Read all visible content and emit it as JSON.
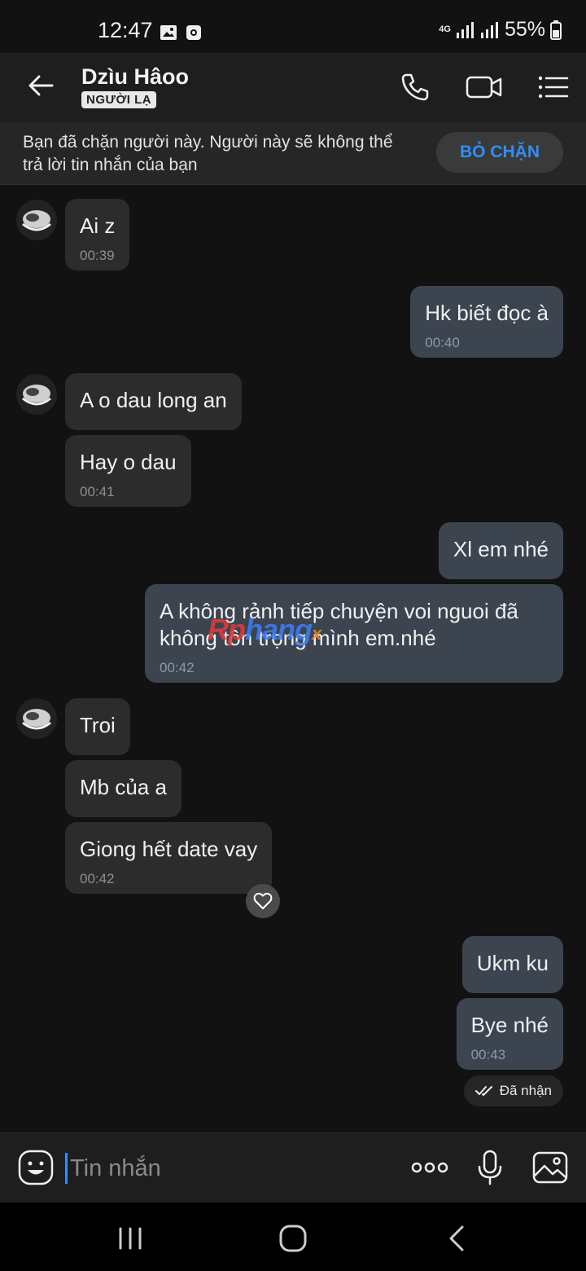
{
  "status_bar": {
    "time": "12:47",
    "network": "4G",
    "battery": "55%"
  },
  "header": {
    "contact_name": "Dzìu Hâoo",
    "badge": "NGƯỜI LẠ"
  },
  "banner": {
    "text": "Bạn đã chặn người này. Người này sẽ không thể trả lời tin nhắn của bạn",
    "unblock_label": "BỎ CHẶN"
  },
  "watermark": {
    "part1": "Rp",
    "part2": "hang",
    "part3": "x"
  },
  "messages": [
    {
      "dir": "in",
      "text": "Ai z",
      "time": "00:39"
    },
    {
      "dir": "out",
      "text": "Hk biết đọc à",
      "time": "00:40"
    },
    {
      "dir": "in",
      "text": "A o dau long an",
      "time": ""
    },
    {
      "dir": "in",
      "text": "Hay o dau",
      "time": "00:41"
    },
    {
      "dir": "out",
      "text": "Xl em nhé",
      "time": ""
    },
    {
      "dir": "out",
      "text": "A không rảnh tiếp chuyện voi nguoi đã không tôn trọng mình em.nhé",
      "time": "00:42"
    },
    {
      "dir": "in",
      "text": "Troi",
      "time": ""
    },
    {
      "dir": "in",
      "text": "Mb của a",
      "time": ""
    },
    {
      "dir": "in",
      "text": "Giong hết date vay",
      "time": "00:42"
    },
    {
      "dir": "out",
      "text": "Ukm ku",
      "time": ""
    },
    {
      "dir": "out",
      "text": "Bye nhé",
      "time": "00:43"
    }
  ],
  "received_status": "Đã nhận",
  "input": {
    "placeholder": "Tin nhắn"
  },
  "icons": {
    "back": "arrow-left-icon",
    "call": "phone-icon",
    "video": "video-call-icon",
    "menu": "list-menu-icon",
    "emoji": "emoji-icon",
    "more": "more-dots-icon",
    "mic": "microphone-icon",
    "gallery": "image-gallery-icon",
    "reaction": "heart-icon",
    "delivered": "double-check-icon"
  },
  "colors": {
    "accent": "#2f8ff7",
    "incoming_bubble": "#2c2c2c",
    "outgoing_bubble": "#3c4450",
    "background": "#121212"
  }
}
